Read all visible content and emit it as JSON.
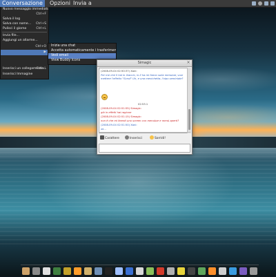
{
  "top_panel": {
    "menus": [
      "Conversazione",
      "Opzioni",
      "Invia a"
    ]
  },
  "conversation_menu": {
    "items": [
      {
        "label": "Nuovo messaggio immediato...",
        "accel": "Ctrl+M"
      },
      {
        "label": "",
        "accel": "Ctrl+F"
      },
      {
        "label": "Salva il log",
        "accel": ""
      },
      {
        "label": "Salva con nome...",
        "accel": "Ctrl+S"
      },
      {
        "label": "Pulisci il giorno",
        "accel": "Ctrl+L"
      },
      {
        "label": "Invia file...",
        "accel": ""
      },
      {
        "label": "Aggiungi un allarme...",
        "accel": ""
      },
      {
        "label": "",
        "accel": "Ctrl+O"
      },
      {
        "label": "",
        "accel": ""
      },
      {
        "label": "",
        "accel": ""
      },
      {
        "label": "Inserisci un collegamento...",
        "accel": "Ctrl+L"
      },
      {
        "label": "Inserisci Immagine",
        "accel": ""
      },
      {
        "label": "",
        "accel": ""
      }
    ]
  },
  "submenu": {
    "items": [
      "Inizia una chat",
      "Accetta automaticamente i trasferimenti file...",
      "Vedi email",
      "View Buddy Icons"
    ]
  },
  "chat_window": {
    "title": "Simagic",
    "close": "×",
    "messages": [
      {
        "header": "(2008-09-04 02:50:37) Xani:",
        "text": "Per me che lì hai in liraccio, lo lì ha mi fanno sulla menubar, vuoi mettere l'effetto \"Scroll\" Uh, e una menichetta..l'oipo seminiale?"
      },
      {
        "time_center": "02:53:1"
      },
      {
        "header": "(2008-09-04 02:51:55) Simagic:",
        "text": "già in effetti hai ragione"
      },
      {
        "header": "(2008-09-04 02:51:15) Simagic:",
        "text": "non è che mi faresti uno screen con menubar e menù aperti?"
      },
      {
        "header": "(2008-09-04 02:51:50) Xani:",
        "text": "ok..."
      }
    ],
    "toolbar": {
      "font": "Carattere",
      "insert": "Inserisci",
      "smile": "Sorridi!"
    }
  },
  "dock": {
    "icon_colors": [
      "#cfa36a",
      "#8a8a8a",
      "#e0e0e0",
      "#3f7f3f",
      "#c4a12a",
      "#ff9d2a",
      "#d0b06a",
      "#6f8fb5",
      "#222222",
      "#a0c0ff",
      "#3a6fd1",
      "#d8d8d8",
      "#8abf5a",
      "#d33b2b",
      "#b0b0b0",
      "#e8d43b",
      "#444444",
      "#5fa65c",
      "#ff8f2a",
      "#cfcfcf",
      "#3a9cdf",
      "#7b5cc0",
      "#9a9a9a"
    ]
  }
}
